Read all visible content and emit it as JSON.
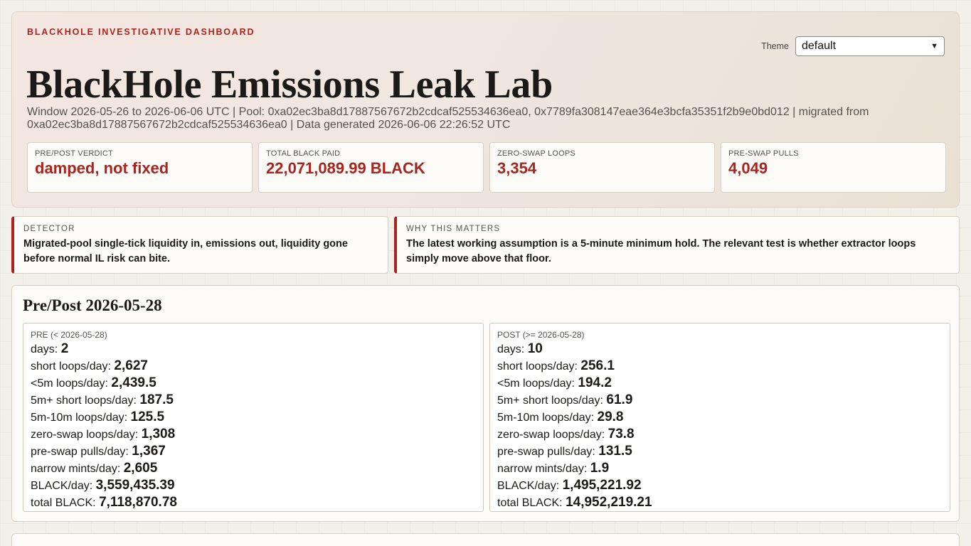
{
  "header": {
    "eyebrow": "BLACKHOLE INVESTIGATIVE DASHBOARD",
    "title": "BlackHole Emissions Leak Lab",
    "meta": "Window 2026-05-26 to 2026-06-06 UTC | Pool: 0xa02ec3ba8d17887567672b2cdcaf525534636ea0, 0x7789fa308147eae364e3bcfa35351f2b9e0bd012 | migrated from 0xa02ec3ba8d17887567672b2cdcaf525534636ea0 | Data generated 2026-06-06 22:26:52 UTC",
    "theme_label": "Theme",
    "theme_value": "default"
  },
  "kpis": [
    {
      "label": "PRE/POST VERDICT",
      "value": "damped, not fixed"
    },
    {
      "label": "TOTAL BLACK PAID",
      "value": "22,071,089.99 BLACK"
    },
    {
      "label": "ZERO-SWAP LOOPS",
      "value": "3,354"
    },
    {
      "label": "PRE-SWAP PULLS",
      "value": "4,049"
    }
  ],
  "callouts": [
    {
      "label": "DETECTOR",
      "text": "Migrated-pool single-tick liquidity in, emissions out, liquidity gone before normal IL risk can bite."
    },
    {
      "label": "WHY THIS MATTERS",
      "text": "The latest working assumption is a 5-minute minimum hold. The relevant test is whether extractor loops simply move above that floor."
    }
  ],
  "prepost": {
    "title": "Pre/Post 2026-05-28",
    "pre": {
      "label": "PRE (< 2026-05-28)",
      "stats": [
        {
          "k": "days:",
          "v": "2"
        },
        {
          "k": "short loops/day:",
          "v": "2,627"
        },
        {
          "k": "<5m loops/day:",
          "v": "2,439.5"
        },
        {
          "k": "5m+ short loops/day:",
          "v": "187.5"
        },
        {
          "k": "5m-10m loops/day:",
          "v": "125.5"
        },
        {
          "k": "zero-swap loops/day:",
          "v": "1,308"
        },
        {
          "k": "pre-swap pulls/day:",
          "v": "1,367"
        },
        {
          "k": "narrow mints/day:",
          "v": "2,605"
        },
        {
          "k": "BLACK/day:",
          "v": "3,559,435.39"
        },
        {
          "k": "total BLACK:",
          "v": "7,118,870.78"
        }
      ]
    },
    "post": {
      "label": "POST (>= 2026-05-28)",
      "stats": [
        {
          "k": "days:",
          "v": "10"
        },
        {
          "k": "short loops/day:",
          "v": "256.1"
        },
        {
          "k": "<5m loops/day:",
          "v": "194.2"
        },
        {
          "k": "5m+ short loops/day:",
          "v": "61.9"
        },
        {
          "k": "5m-10m loops/day:",
          "v": "29.8"
        },
        {
          "k": "zero-swap loops/day:",
          "v": "73.8"
        },
        {
          "k": "pre-swap pulls/day:",
          "v": "131.5"
        },
        {
          "k": "narrow mints/day:",
          "v": "1.9"
        },
        {
          "k": "BLACK/day:",
          "v": "1,495,221.92"
        },
        {
          "k": "total BLACK:",
          "v": "14,952,219.21"
        }
      ]
    }
  },
  "icons": {
    "theme_select": "chevron-down-icon"
  }
}
